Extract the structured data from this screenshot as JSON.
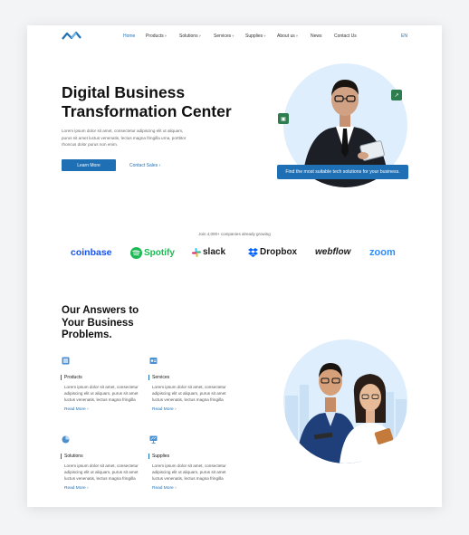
{
  "nav": {
    "items": [
      {
        "label": "Home",
        "caret": false,
        "active": true
      },
      {
        "label": "Products",
        "caret": true
      },
      {
        "label": "Solutions",
        "caret": true
      },
      {
        "label": "Services",
        "caret": true
      },
      {
        "label": "Supplies",
        "caret": true
      },
      {
        "label": "About us",
        "caret": true
      },
      {
        "label": "News",
        "caret": false
      },
      {
        "label": "Contact Us",
        "caret": false
      }
    ],
    "caret_glyph": "˅",
    "lang": "EN"
  },
  "hero": {
    "title": "Digital Business Transformation Center",
    "description": "Lorem ipsum dolor sit amet, consectetur adipiscing elit ut aliquam, purus sit amet luctus venenatis, lectus magna fringilla urna, porttitor rhoncus dolor purus non enim.",
    "primary_button": "Learn More",
    "secondary_link": "Contact Sales",
    "link_arrow": "›",
    "badge": "Find the most suitable tech solutions for your business."
  },
  "clients": {
    "caption": "Join 4,000+ companies already growing",
    "brands": [
      {
        "name": "coinbase",
        "color": "#1652f0"
      },
      {
        "name": "Spotify",
        "color": "#1db954"
      },
      {
        "name": "slack",
        "color": "#1a1a1a"
      },
      {
        "name": "Dropbox",
        "color": "#1a1a1a"
      },
      {
        "name": "webflow",
        "color": "#1a1a1a"
      },
      {
        "name": "zoom",
        "color": "#2d8cff"
      }
    ]
  },
  "answers": {
    "title": "Our Answers to Your Business Problems.",
    "services": [
      {
        "title": "Products",
        "desc": "Lorem ipsum dolor sit amet, consectetur adipiscing elit ut aliquam, purus sit amet luctus venenatis, lectus magna fringilla",
        "link": "Read More"
      },
      {
        "title": "Services",
        "desc": "Lorem ipsum dolor sit amet, consectetur adipiscing elit ut aliquam, purus sit amet luctus venenatis, lectus magna fringilla",
        "link": "Read More"
      },
      {
        "title": "Solutions",
        "desc": "Lorem ipsum dolor sit amet, consectetur adipiscing elit ut aliquam, purus sit amet luctus venenatis, lectus magna fringilla",
        "link": "Read More"
      },
      {
        "title": "Supplies",
        "desc": "Lorem ipsum dolor sit amet, consectetur adipiscing elit ut aliquam, purus sit amet luctus venenatis, lectus magna fringilla",
        "link": "Read More"
      }
    ]
  },
  "colors": {
    "accent": "#1f6fb5",
    "green": "#2e7d4f",
    "circle_bg": "#dfeefc"
  }
}
